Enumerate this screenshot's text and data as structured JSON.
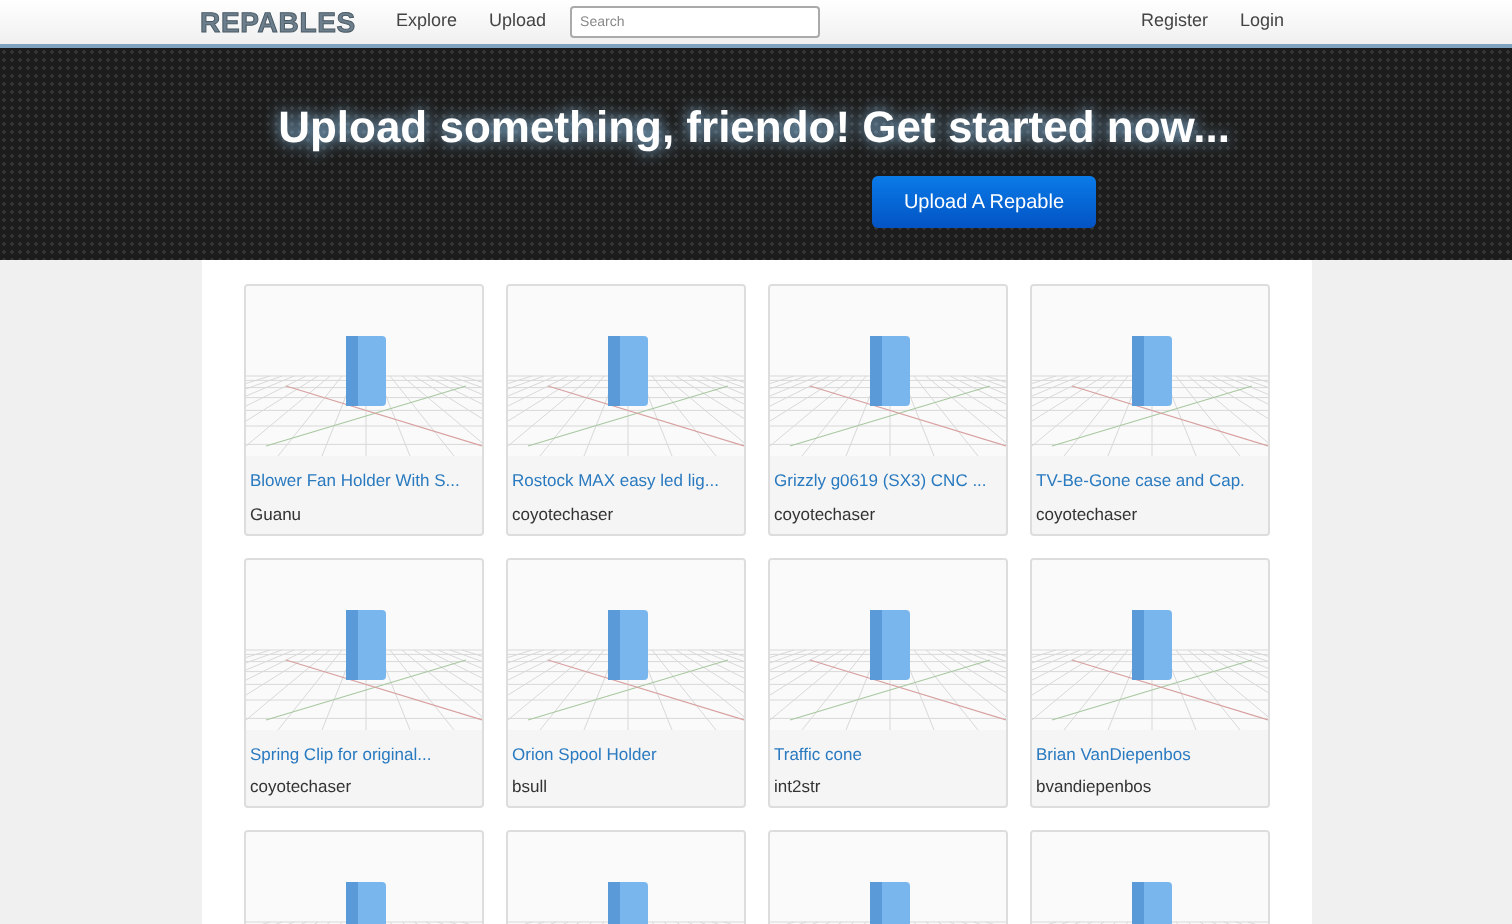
{
  "navbar": {
    "logo": "REPABLES",
    "links": [
      {
        "label": "Explore"
      },
      {
        "label": "Upload"
      }
    ],
    "search": {
      "placeholder": "Search"
    },
    "account_links": [
      {
        "label": "Register"
      },
      {
        "label": "Login"
      }
    ]
  },
  "hero": {
    "headline": "Upload something, friendo! Get started now...",
    "button": "Upload A Repable"
  },
  "cards": [
    {
      "kind": "model",
      "title": "Blower Fan Holder With S...",
      "author": "Guanu"
    },
    {
      "kind": "model",
      "title": "Rostock MAX easy led lig...",
      "author": "coyotechaser"
    },
    {
      "kind": "model",
      "title": "Grizzly g0619 (SX3) CNC ...",
      "author": "coyotechaser"
    },
    {
      "kind": "model",
      "title": "TV-Be-Gone case and Cap.",
      "author": "coyotechaser"
    },
    {
      "kind": "model",
      "title": "Spring Clip for original...",
      "author": "coyotechaser"
    },
    {
      "kind": "model",
      "title": "Orion Spool Holder",
      "author": "bsull"
    },
    {
      "kind": "model",
      "title": "Traffic cone",
      "author": "int2str"
    },
    {
      "kind": "model",
      "title": "Brian VanDiepenbos",
      "author": "bvandiepenbos"
    },
    {
      "kind": "preview-only"
    },
    {
      "kind": "preview-only"
    },
    {
      "kind": "preview-only"
    },
    {
      "kind": "preview-only"
    }
  ]
}
